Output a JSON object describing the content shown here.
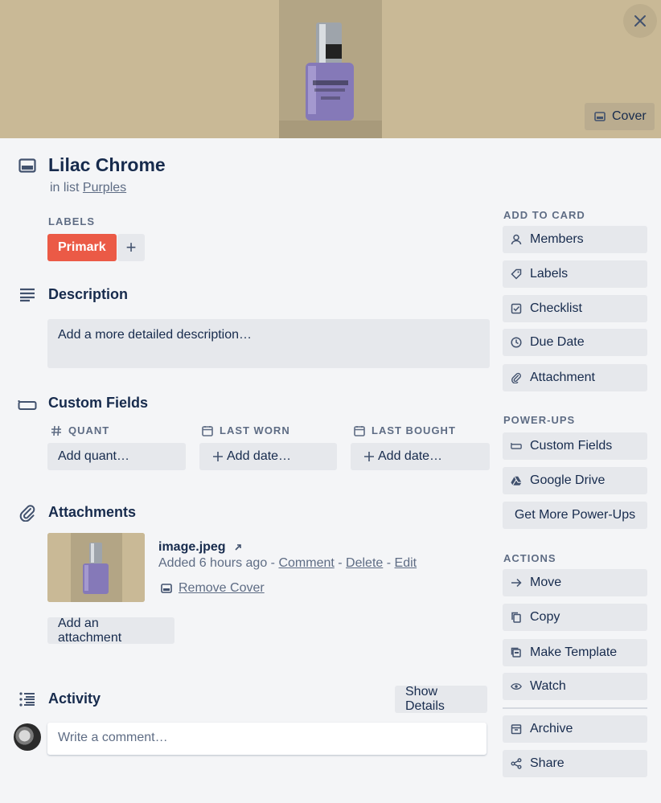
{
  "card": {
    "title": "Lilac Chrome",
    "in_list_prefix": "in list",
    "list_name": "Purples"
  },
  "cover": {
    "button_label": "Cover",
    "color": "#c9b996"
  },
  "labels": {
    "heading": "LABELS",
    "items": [
      {
        "name": "Primark",
        "color": "#eb5a46"
      }
    ],
    "add_symbol": "+"
  },
  "description": {
    "heading": "Description",
    "placeholder": "Add a more detailed description…"
  },
  "custom_fields": {
    "heading": "Custom Fields",
    "fields": [
      {
        "name": "QUANT",
        "button": "Add quant…",
        "icon": "hash-icon"
      },
      {
        "name": "LAST WORN",
        "button": "Add date…",
        "icon": "calendar-icon"
      },
      {
        "name": "LAST BOUGHT",
        "button": "Add date…",
        "icon": "calendar-icon"
      }
    ]
  },
  "attachments": {
    "heading": "Attachments",
    "file_name": "image.jpeg",
    "added": "Added 6 hours ago",
    "separator": "-",
    "actions": [
      "Comment",
      "Delete",
      "Edit"
    ],
    "remove_cover": "Remove Cover",
    "add_button": "Add an attachment"
  },
  "activity": {
    "heading": "Activity",
    "show_details": "Show Details",
    "comment_placeholder": "Write a comment…"
  },
  "sidebar": {
    "add_to_card": {
      "heading": "ADD TO CARD",
      "items": [
        {
          "label": "Members",
          "icon": "person-icon"
        },
        {
          "label": "Labels",
          "icon": "tag-icon"
        },
        {
          "label": "Checklist",
          "icon": "checkbox-icon"
        },
        {
          "label": "Due Date",
          "icon": "clock-icon"
        },
        {
          "label": "Attachment",
          "icon": "paperclip-icon"
        }
      ]
    },
    "power_ups": {
      "heading": "POWER-UPS",
      "items": [
        {
          "label": "Custom Fields",
          "icon": "custom-fields-icon"
        },
        {
          "label": "Google Drive",
          "icon": "google-drive-icon"
        }
      ],
      "more": "Get More Power-Ups"
    },
    "actions": {
      "heading": "ACTIONS",
      "items": [
        {
          "label": "Move",
          "icon": "arrow-right-icon"
        },
        {
          "label": "Copy",
          "icon": "copy-icon"
        },
        {
          "label": "Make Template",
          "icon": "template-icon"
        },
        {
          "label": "Watch",
          "icon": "eye-icon"
        },
        {
          "label": "Archive",
          "icon": "archive-icon"
        },
        {
          "label": "Share",
          "icon": "share-icon"
        }
      ]
    }
  }
}
